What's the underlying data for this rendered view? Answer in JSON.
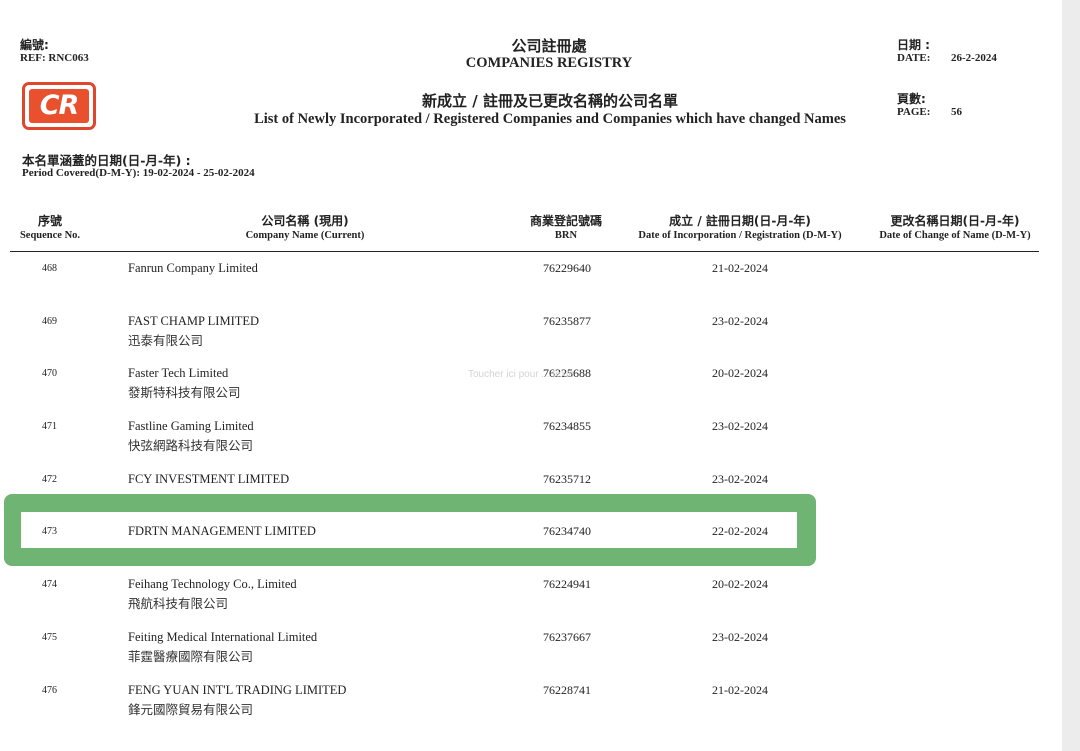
{
  "header": {
    "ref_cn": "編號:",
    "ref_en": "REF: RNC063",
    "title_cn": "公司註冊處",
    "title_en": "COMPANIES REGISTRY",
    "subtitle_cn": "新成立 / 註冊及已更改名稱的公司名單",
    "subtitle_en": "List of Newly Incorporated / Registered Companies and Companies which have changed Names",
    "date_cn": "日期 :",
    "date_label": "DATE:",
    "date_value": "26-2-2024",
    "page_cn": "頁數:",
    "page_label": "PAGE:",
    "page_value": "56",
    "logo_text": "CR"
  },
  "period": {
    "cn": "本名單涵蓋的日期(日-月-年) :",
    "en": "Period Covered(D-M-Y): 19-02-2024 - 25-02-2024"
  },
  "columns": {
    "seq_cn": "序號",
    "seq_en": "Sequence No.",
    "name_cn": "公司名稱 (現用)",
    "name_en": "Company Name (Current)",
    "brn_cn": "商業登記號碼",
    "brn_en": "BRN",
    "inc_cn": "成立 / 註冊日期(日-月-年)",
    "inc_en": "Date of Incorporation / Registration (D-M-Y)",
    "chg_cn": "更改名稱日期(日-月-年)",
    "chg_en": "Date of Change of Name (D-M-Y)"
  },
  "rows": [
    {
      "seq": "468",
      "name_en": "Fanrun Company Limited",
      "name_cn": "",
      "brn": "76229640",
      "date": "21-02-2024"
    },
    {
      "seq": "469",
      "name_en": "FAST CHAMP LIMITED",
      "name_cn": "迅泰有限公司",
      "brn": "76235877",
      "date": "23-02-2024"
    },
    {
      "seq": "470",
      "name_en": "Faster Tech Limited",
      "name_cn": "發斯特科技有限公司",
      "brn": "76225688",
      "date": "20-02-2024"
    },
    {
      "seq": "471",
      "name_en": "Fastline Gaming Limited",
      "name_cn": "快弦網路科技有限公司",
      "brn": "76234855",
      "date": "23-02-2024"
    },
    {
      "seq": "472",
      "name_en": "FCY INVESTMENT LIMITED",
      "name_cn": "",
      "brn": "76235712",
      "date": "23-02-2024"
    },
    {
      "seq": "473",
      "name_en": "FDRTN MANAGEMENT LIMITED",
      "name_cn": "",
      "brn": "76234740",
      "date": "22-02-2024"
    },
    {
      "seq": "474",
      "name_en": "Feihang Technology Co., Limited",
      "name_cn": "飛航科技有限公司",
      "brn": "76224941",
      "date": "20-02-2024"
    },
    {
      "seq": "475",
      "name_en": "Feiting Medical International Limited",
      "name_cn": "菲霆醫療國際有限公司",
      "brn": "76237667",
      "date": "23-02-2024"
    },
    {
      "seq": "476",
      "name_en": "FENG YUAN INT'L TRADING LIMITED",
      "name_cn": "鋒元國際貿易有限公司",
      "brn": "76228741",
      "date": "21-02-2024"
    }
  ],
  "watermark": "Toucher ici pour ... texte",
  "colors": {
    "highlight": "#6fb472",
    "logo": "#e8502e"
  }
}
